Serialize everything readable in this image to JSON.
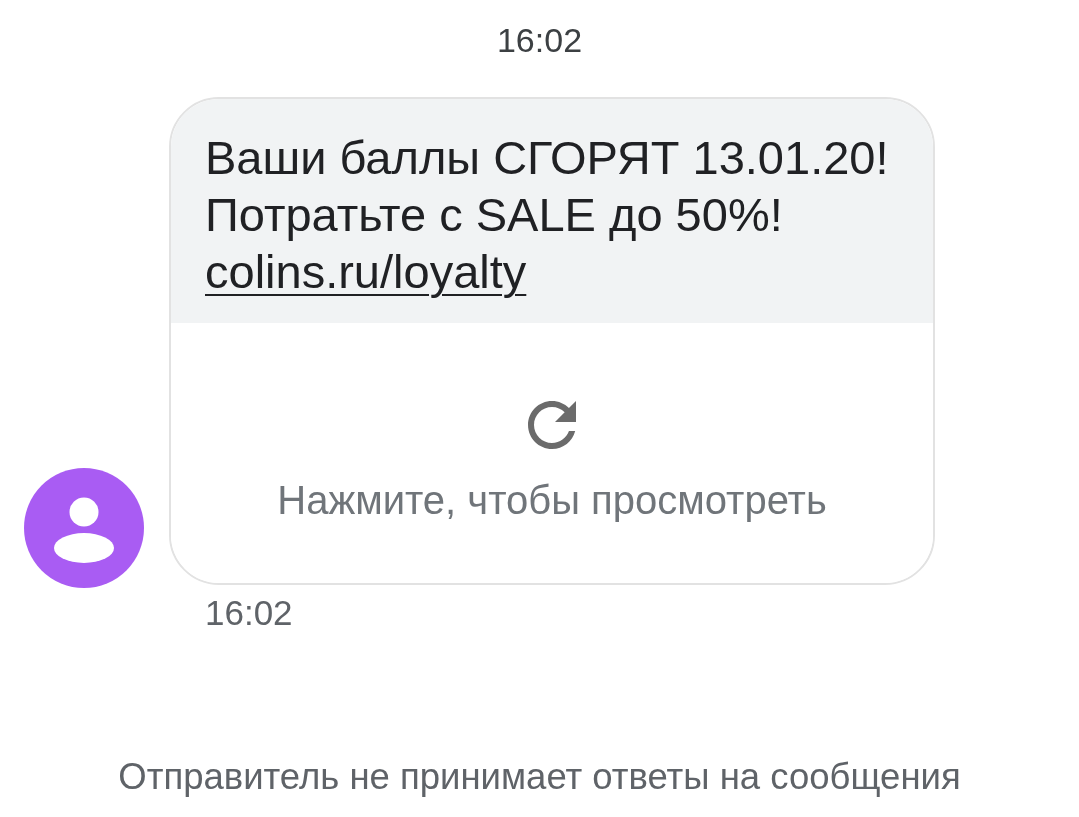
{
  "header": {
    "timestamp": "16:02"
  },
  "message": {
    "text_lines": [
      "Ваши баллы СГОРЯТ 13.01.20!",
      "Потратьте с SALE до 50%!"
    ],
    "link": "colins.ru/loyalty",
    "preview": {
      "label": "Нажмите, чтобы просмотреть"
    },
    "timestamp": "16:02"
  },
  "footer": {
    "notice": "Отправитель не принимает ответы на сообщения"
  }
}
